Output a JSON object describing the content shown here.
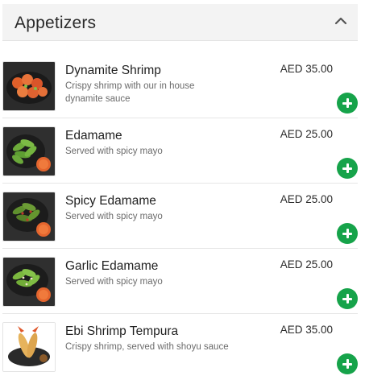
{
  "section": {
    "title": "Appetizers",
    "collapse_icon": "chevron-up-icon"
  },
  "items": [
    {
      "name": "Dynamite Shrimp",
      "description": "Crispy shrimp with our in house dynamite sauce",
      "price": "AED 35.00",
      "image": "dynamite-shrimp-photo"
    },
    {
      "name": "Edamame",
      "description": "Served with spicy mayo",
      "price": "AED 25.00",
      "image": "edamame-photo"
    },
    {
      "name": "Spicy Edamame",
      "description": "Served with spicy mayo",
      "price": "AED 25.00",
      "image": "spicy-edamame-photo"
    },
    {
      "name": "Garlic Edamame",
      "description": "Served with spicy mayo",
      "price": "AED 25.00",
      "image": "garlic-edamame-photo"
    },
    {
      "name": "Ebi Shrimp Tempura",
      "description": "Crispy shrimp, served with shoyu sauce",
      "price": "AED 35.00",
      "image": "ebi-shrimp-tempura-photo"
    }
  ],
  "add_icon": "plus-circle-icon",
  "colors": {
    "add_button": "#16a34a",
    "header_background": "#f3f3f3"
  }
}
